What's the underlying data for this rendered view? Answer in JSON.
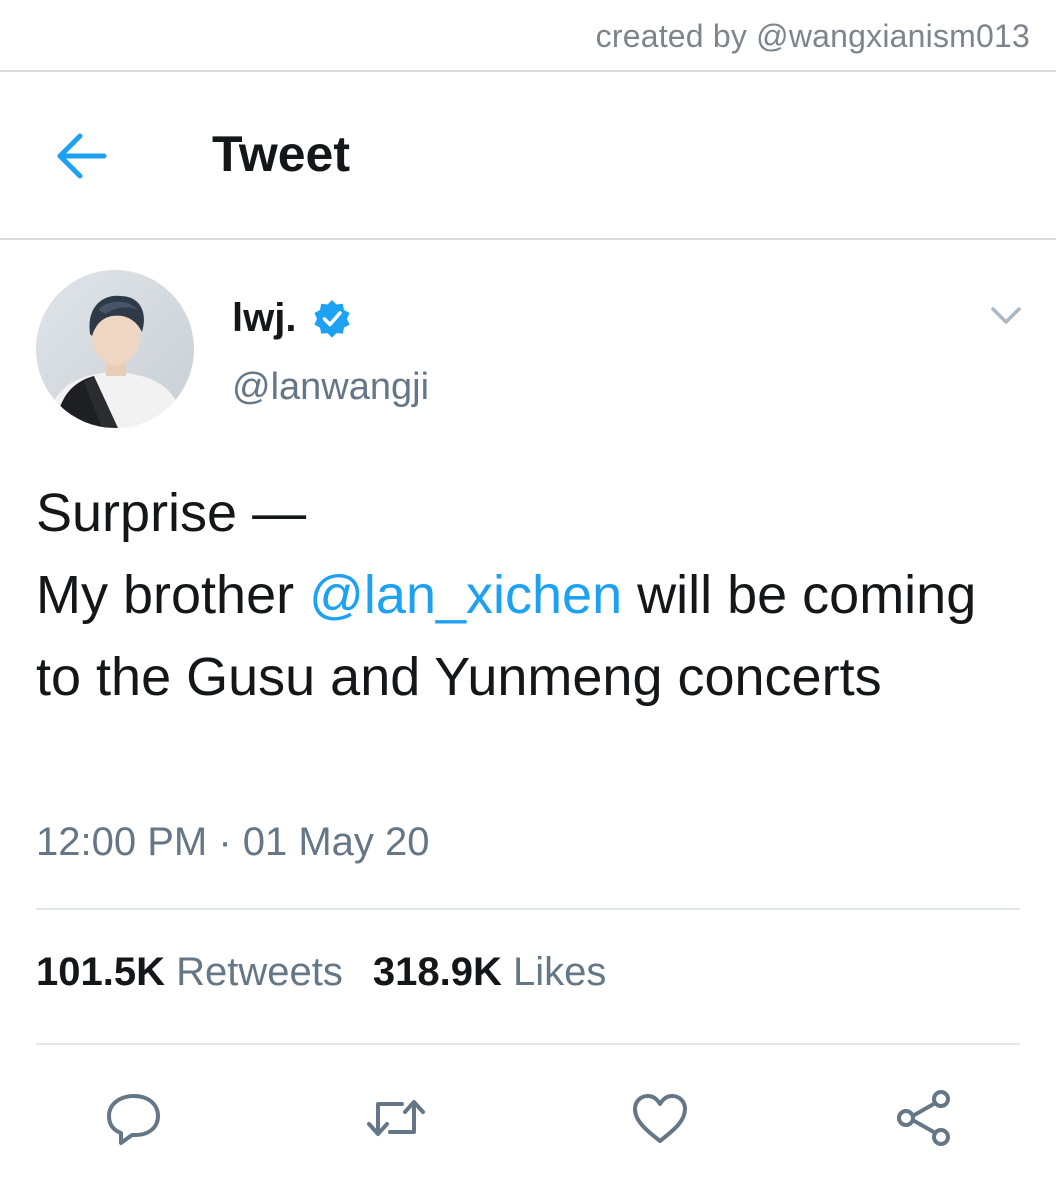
{
  "credit": {
    "text": "created by @wangxianism013"
  },
  "header": {
    "back_icon": "back-arrow-icon",
    "title": "Tweet"
  },
  "tweet": {
    "author": {
      "name": "lwj.",
      "handle": "@lanwangji",
      "verified_icon": "verified-badge-icon",
      "avatar": "profile-photo"
    },
    "more_icon": "chevron-down-icon",
    "text": {
      "line1": "Surprise —",
      "before_mention": "My brother ",
      "mention": "@lan_xichen",
      "after_mention": " will be coming to the Gusu and Yunmeng concerts"
    },
    "timestamp": "12:00 PM · 01 May 20",
    "stats": {
      "retweets_count": "101.5K",
      "retweets_label": "Retweets",
      "likes_count": "318.9K",
      "likes_label": "Likes"
    },
    "actions": [
      {
        "name": "reply",
        "icon": "reply-icon"
      },
      {
        "name": "retweet",
        "icon": "retweet-icon"
      },
      {
        "name": "like",
        "icon": "heart-icon"
      },
      {
        "name": "share",
        "icon": "share-icon"
      }
    ]
  },
  "colors": {
    "accent": "#1da1f2",
    "text_primary": "#14171a",
    "text_secondary": "#657786",
    "divider": "#e1e6ea",
    "background": "#ffffff"
  }
}
